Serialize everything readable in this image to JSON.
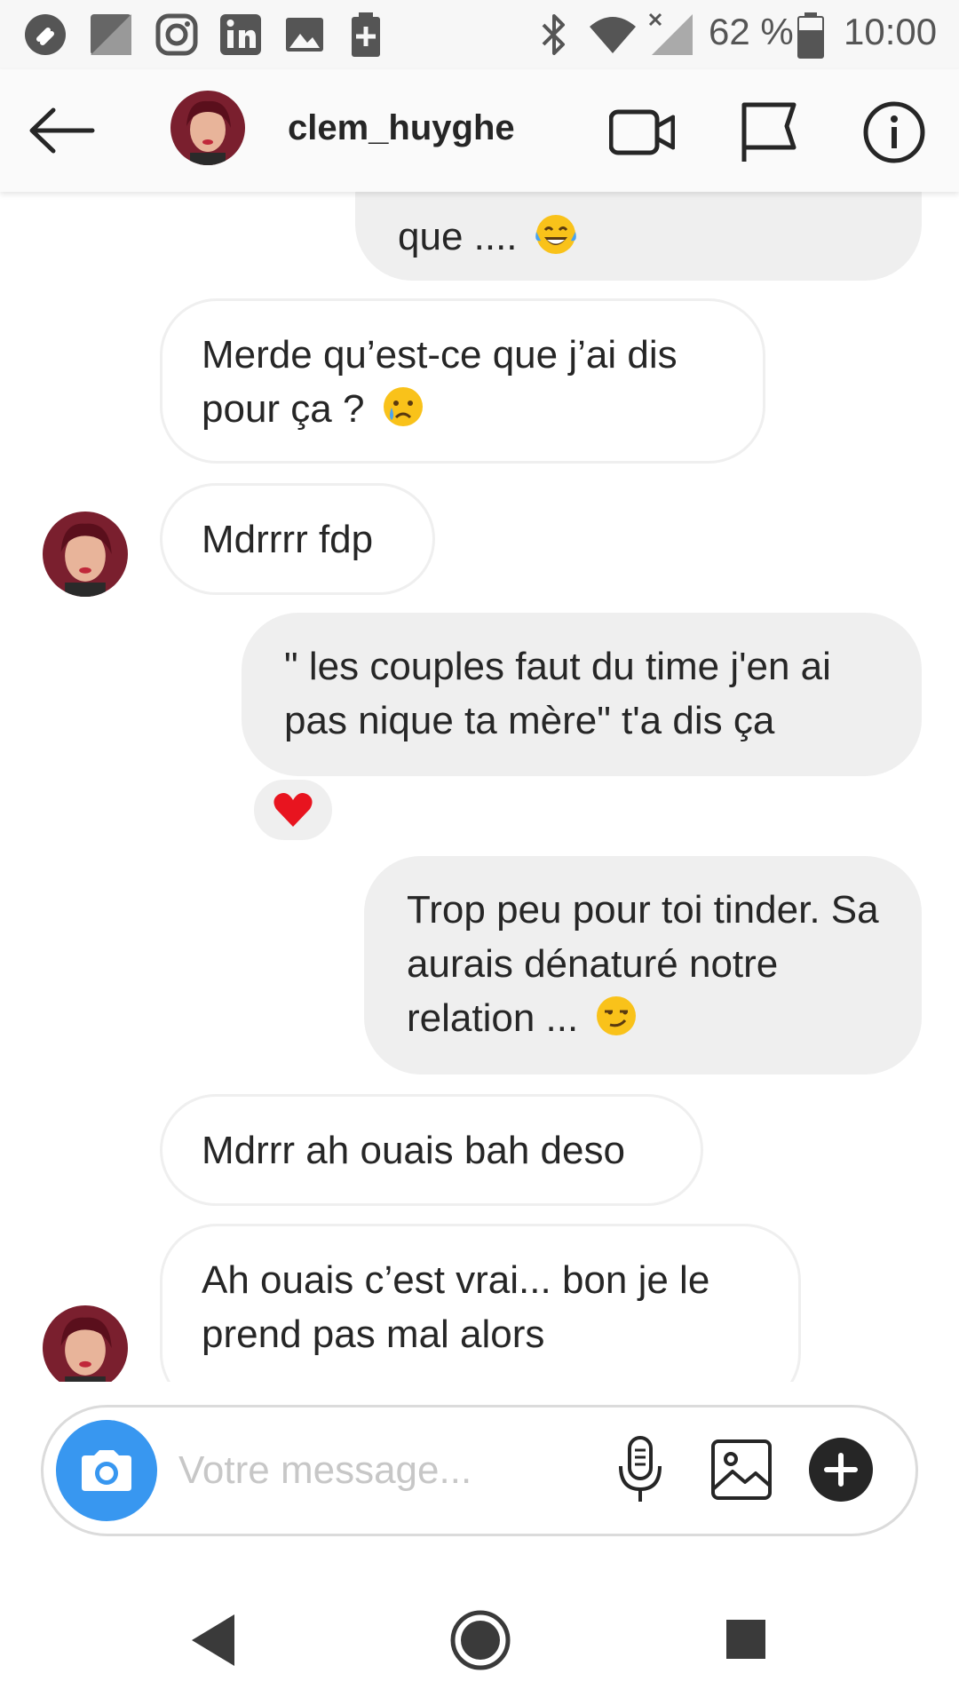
{
  "status_bar": {
    "battery": "62 %",
    "time": "10:00"
  },
  "header": {
    "username": "clem_huyghe"
  },
  "messages": [
    {
      "side": "out",
      "text": "que ....",
      "emoji": "laughing-tears"
    },
    {
      "side": "in",
      "text": "Merde qu’est-ce que j’ai dis pour ça ?",
      "emoji": "crying"
    },
    {
      "side": "in",
      "text": "Mdrrrr fdp"
    },
    {
      "side": "out",
      "text": "\" les couples faut du time j'en ai pas nique ta mère\" t'a dis ça",
      "reaction": "heart"
    },
    {
      "side": "out",
      "text": "Trop peu pour toi tinder. Sa aurais dénaturé notre relation ...",
      "emoji": "smirk"
    },
    {
      "side": "in",
      "text": "Mdrrr ah ouais bah deso"
    },
    {
      "side": "in",
      "text": "Ah ouais c’est vrai... bon je le prend pas mal alors"
    }
  ],
  "composer": {
    "placeholder": "Votre message..."
  },
  "colors": {
    "accent": "#3897f0",
    "incoming_border": "#efefef",
    "outgoing_bg": "#efefef",
    "heart": "#e8141f"
  },
  "icons": [
    "back-arrow-icon",
    "video-call-icon",
    "flag-icon",
    "info-icon",
    "camera-icon",
    "microphone-icon",
    "gallery-icon",
    "plus-icon"
  ]
}
